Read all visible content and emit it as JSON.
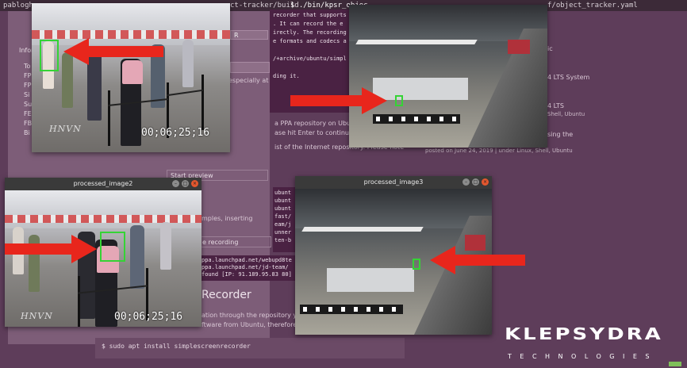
{
  "terminal": {
    "prompt_user": "pablogh",
    "path_fragment": "ct-tracker/build",
    "cmd_fragment": "$ ./bin/kpsr_objec",
    "yaml_fragment": "f/object_tracker.yaml"
  },
  "middle_terminal": {
    "lines": [
      "recorder that supports",
      ". It can record the e",
      "irectly. The recording",
      "e formats and codecs a",
      "",
      "/+archive/ubuntu/simpl",
      "",
      "ding it."
    ]
  },
  "left_page": {
    "sidebar_labels": [
      "Inform",
      "To",
      "FP",
      "FP",
      "Si",
      "Su",
      "FE",
      "FB",
      "Bi"
    ],
    "dropdown_value": "R",
    "especially": "especially at",
    "start_preview": "Start preview",
    "samples_inserting": "mples, inserting",
    "recording": "e recording"
  },
  "right_page": {
    "ppa_text": "a PPA repository on Ubu",
    "enter_text": "ase hit Enter to continue",
    "internet_text": "ist of the Internet repository. Please note",
    "posted_text": "posted on June 24, 2019 | under Linux, Shell, Ubuntu",
    "lts_system": "4 LTS System",
    "lts": "4 LTS",
    "shell_ubuntu": "Shell, Ubuntu",
    "using_the": "sing the",
    "ic": "ic",
    "recorder_heading": "Recorder",
    "repo_text": "ation through the repository you j",
    "ubuntu_text": "ftware from Ubuntu, therefore en",
    "install_cmd": "$ sudo apt install simplescreenrecorder"
  },
  "mid_terminal_2": {
    "lines": [
      "ubunt",
      "ubunt",
      "ubunt",
      "fast/",
      "eam/j",
      "unner",
      "ten-b"
    ]
  },
  "mid_terminal_3": {
    "lines": [
      "ppa.launchpad.net/webupd8te",
      "ppa.launchpad.net/jd-team/",
      "found [IP: 91.189.95.83 80]"
    ]
  },
  "windows": {
    "top_left": {
      "title": "",
      "timecode": "00;06;25;16",
      "brand": "HNVN"
    },
    "top_right": {
      "title": ""
    },
    "bottom_left": {
      "title": "processed_image2",
      "timecode": "00;06;25;16",
      "brand": "HNVN"
    },
    "bottom_right": {
      "title": "processed_image3"
    }
  },
  "logo": {
    "main": "KLEPSYDRA",
    "sub": "TECHNOLOGIES"
  },
  "colors": {
    "arrow": "#e8261c",
    "bbox": "#35d335",
    "background": "#5e3d5a"
  }
}
